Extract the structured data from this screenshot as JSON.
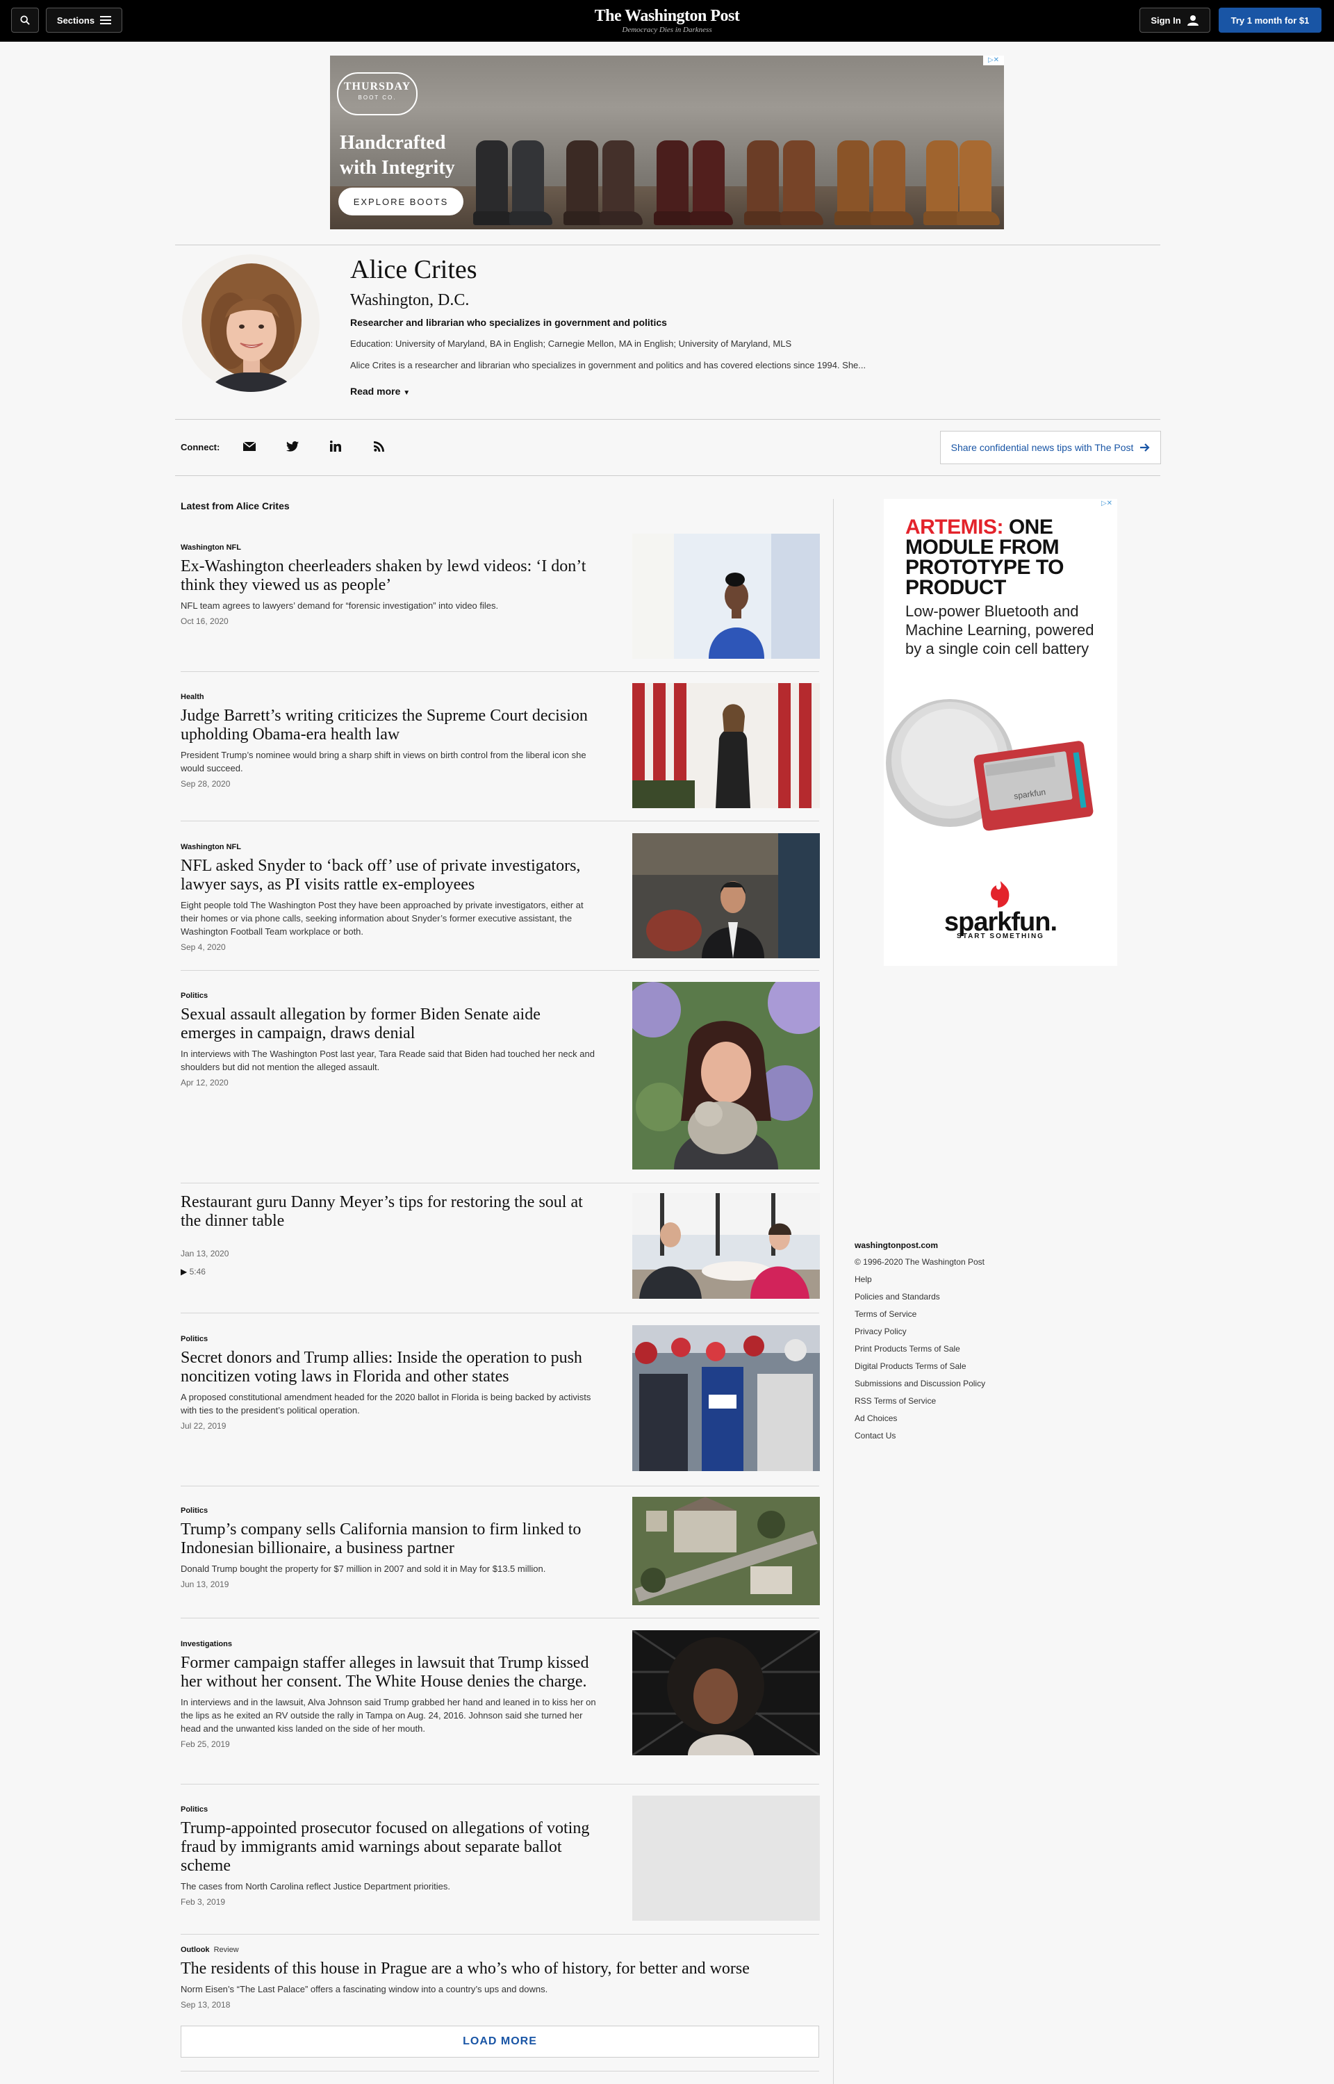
{
  "header": {
    "sections_label": "Sections",
    "logo": "The Washington Post",
    "tagline": "Democracy Dies in Darkness",
    "signin_label": "Sign In",
    "subscribe_label": "Try 1 month for $1"
  },
  "ad_banner": {
    "brand": "THURSDAY",
    "brand_sub": "BOOT CO.",
    "headline_line1": "Handcrafted",
    "headline_line2": "with Integrity",
    "cta": "EXPLORE BOOTS"
  },
  "author": {
    "name": "Alice Crites",
    "location": "Washington, D.C.",
    "role": "Researcher and librarian who specializes in government and politics",
    "education": "Education: University of Maryland, BA in English; Carnegie Mellon, MA in English; University of Maryland, MLS",
    "bio": "Alice Crites is a researcher and librarian who specializes in government and politics and has covered elections since 1994. She...",
    "read_more": "Read more"
  },
  "connect": {
    "label": "Connect:",
    "tips_label": "Share confidential news tips with The Post"
  },
  "latest_heading": "Latest from Alice Crites",
  "articles": [
    {
      "kicker": "Washington NFL",
      "kicker_sub": "",
      "title": "Ex-Washington cheerleaders shaken by lewd videos: ‘I don’t think they viewed us as people’",
      "blurb": "NFL team agrees to lawyers’ demand for “forensic investigation” into video files.",
      "date": "Oct 16, 2020"
    },
    {
      "kicker": "Health",
      "kicker_sub": "",
      "title": "Judge Barrett’s writing criticizes the Supreme Court decision upholding Obama-era health law",
      "blurb": "President Trump’s nominee would bring a sharp shift in views on birth control from the liberal icon she would succeed.",
      "date": "Sep 28, 2020"
    },
    {
      "kicker": "Washington NFL",
      "kicker_sub": "",
      "title": "NFL asked Snyder to ‘back off’ use of private investigators, lawyer says, as PI visits rattle ex-employees",
      "blurb": "Eight people told The Washington Post they have been approached by private investigators, either at their homes or via phone calls, seeking information about Snyder’s former executive assistant, the Washington Football Team workplace or both.",
      "date": "Sep 4, 2020"
    },
    {
      "kicker": "Politics",
      "kicker_sub": "",
      "title": "Sexual assault allegation by former Biden Senate aide emerges in campaign, draws denial",
      "blurb": "In interviews with The Washington Post last year, Tara Reade said that Biden had touched her neck and shoulders but did not mention the alleged assault.",
      "date": "Apr 12, 2020"
    },
    {
      "kicker": "",
      "kicker_sub": "",
      "title": "Restaurant guru Danny Meyer’s tips for restoring the soul at the dinner table",
      "blurb": "",
      "date": "Jan 13, 2020",
      "duration": "5:46"
    },
    {
      "kicker": "Politics",
      "kicker_sub": "",
      "title": "Secret donors and Trump allies: Inside the operation to push noncitizen voting laws in Florida and other states",
      "blurb": "A proposed constitutional amendment headed for the 2020 ballot in Florida is being backed by activists with ties to the president’s political operation.",
      "date": "Jul 22, 2019"
    },
    {
      "kicker": "Politics",
      "kicker_sub": "",
      "title": "Trump’s company sells California mansion to firm linked to Indonesian billionaire, a business partner",
      "blurb": "Donald Trump bought the property for $7 million in 2007 and sold it in May for $13.5 million.",
      "date": "Jun 13, 2019"
    },
    {
      "kicker": "Investigations",
      "kicker_sub": "",
      "title": "Former campaign staffer alleges in lawsuit that Trump kissed her without her consent. The White House denies the charge.",
      "blurb": "In interviews and in the lawsuit, Alva Johnson said Trump grabbed her hand and leaned in to kiss her on the lips as he exited an RV outside the rally in Tampa on Aug. 24, 2016. Johnson said she turned her head and the unwanted kiss landed on the side of her mouth.",
      "date": "Feb 25, 2019"
    },
    {
      "kicker": "Politics",
      "kicker_sub": "",
      "title": "Trump-appointed prosecutor focused on allegations of voting fraud by immigrants amid warnings about separate ballot scheme",
      "blurb": "The cases from North Carolina reflect Justice Department priorities.",
      "date": "Feb 3, 2019"
    },
    {
      "kicker": "Outlook",
      "kicker_sub": "Review",
      "title": "The residents of this house in Prague are a who’s who of history, for better and worse",
      "blurb": "Norm Eisen’s “The Last Palace” offers a fascinating window into a country’s ups and downs.",
      "date": "Sep 13, 2018"
    }
  ],
  "load_more": "LOAD MORE",
  "ad_side": {
    "headline_red": "ARTEMIS:",
    "headline_rest": " ONE MODULE FROM PROTOTYPE TO PRODUCT",
    "subhead": "Low-power Bluetooth and Machine Learning, powered by a single coin cell battery",
    "logo": "sparkfun.",
    "logo_sub": "START SOMETHING",
    "board_text": "sparkfun"
  },
  "footer": {
    "site": "washingtonpost.com",
    "links": [
      "© 1996-2020 The Washington Post",
      "Help",
      "Policies and Standards",
      "Terms of Service",
      "Privacy Policy",
      "Print Products Terms of Sale",
      "Digital Products Terms of Sale",
      "Submissions and Discussion Policy",
      "RSS Terms of Service",
      "Ad Choices",
      "Contact Us"
    ]
  },
  "colors": {
    "accent": "#1955a5",
    "topbar": "#000000",
    "page_bg": "#f7f7f7",
    "sparkfun_red": "#e3232b"
  }
}
